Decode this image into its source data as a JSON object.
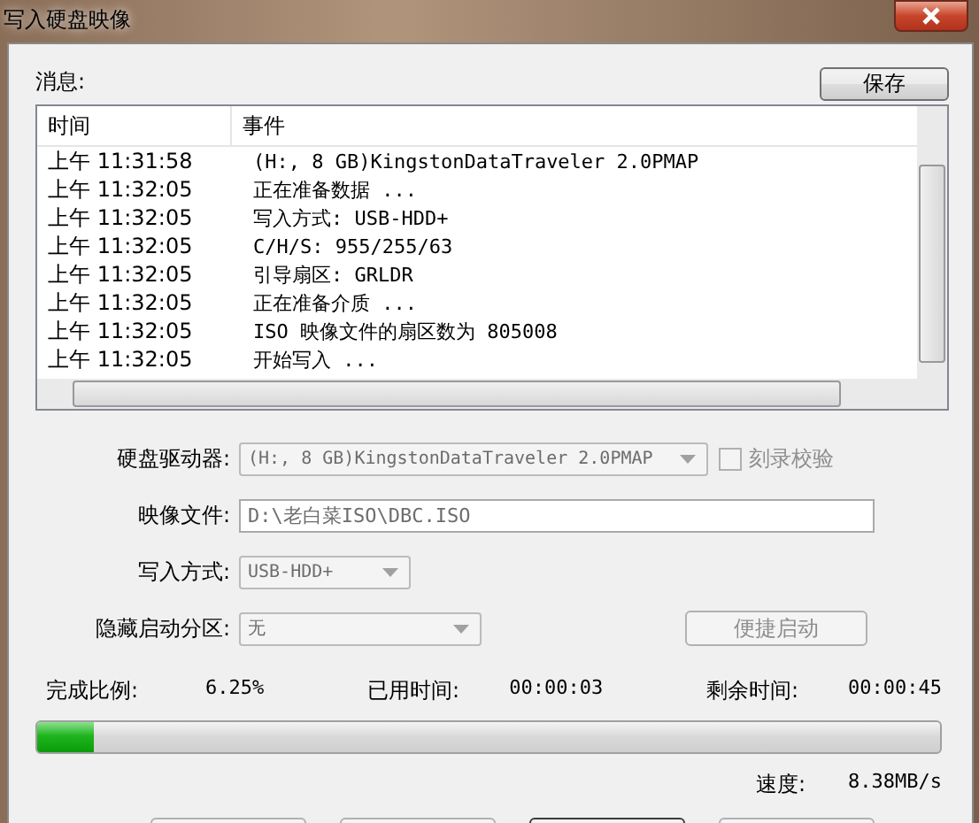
{
  "window": {
    "title": "写入硬盘映像"
  },
  "messages": {
    "label": "消息:",
    "save_button": {
      "label": "保存",
      "disabled": false
    },
    "columns": [
      "时间",
      "事件"
    ],
    "rows": [
      {
        "time": "上午 11:31:58",
        "event": "(H:, 8 GB)KingstonDataTraveler 2.0PMAP"
      },
      {
        "time": "上午 11:32:05",
        "event": "正在准备数据 ..."
      },
      {
        "time": "上午 11:32:05",
        "event": "写入方式: USB-HDD+"
      },
      {
        "time": "上午 11:32:05",
        "event": "C/H/S: 955/255/63"
      },
      {
        "time": "上午 11:32:05",
        "event": "引导扇区: GRLDR"
      },
      {
        "time": "上午 11:32:05",
        "event": "正在准备介质 ..."
      },
      {
        "time": "上午 11:32:05",
        "event": "ISO 映像文件的扇区数为 805008"
      },
      {
        "time": "上午 11:32:05",
        "event": "开始写入 ..."
      }
    ]
  },
  "form": [
    {
      "kind": "combo",
      "label": "硬盘驱动器:",
      "value": "(H:, 8 GB)KingstonDataTraveler 2.0PMAP",
      "disabled": true,
      "checkbox": {
        "label": "刻录校验",
        "checked": false,
        "disabled": true
      }
    },
    {
      "kind": "text",
      "label": "映像文件:",
      "value": "D:\\老白菜ISO\\DBC.ISO",
      "disabled": true
    },
    {
      "kind": "combo",
      "label": "写入方式:",
      "value": "USB-HDD+",
      "disabled": true
    },
    {
      "kind": "combo",
      "label": "隐藏启动分区:",
      "value": "无",
      "disabled": true,
      "button": {
        "label": "便捷启动",
        "disabled": true
      }
    }
  ],
  "progress": {
    "stats": [
      {
        "label": "完成比例:",
        "value": "6.25%"
      },
      {
        "label": "已用时间:",
        "value": "00:00:03"
      },
      {
        "label": "剩余时间:",
        "value": "00:00:45"
      }
    ],
    "level": 0.0625,
    "speed_label": "速度:",
    "speed": "8.38MB/s"
  },
  "bottom_buttons": [
    {
      "disabled": true
    },
    {
      "disabled": true
    },
    {
      "disabled": false
    },
    {
      "disabled": true
    }
  ]
}
